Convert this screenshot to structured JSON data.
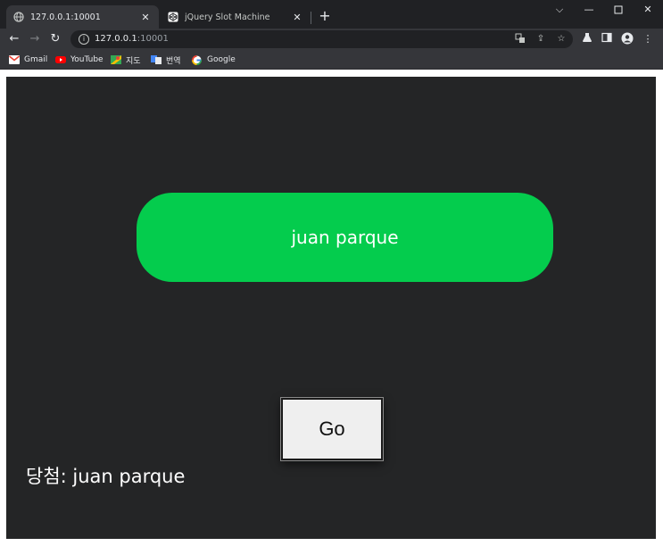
{
  "browser": {
    "tabs": [
      {
        "title": "127.0.0.1:10001",
        "active": true
      },
      {
        "title": "jQuery Slot Machine",
        "active": false
      }
    ],
    "new_tab_glyph": "+",
    "url_host": "127.0.0.1",
    "url_port": ":10001",
    "bookmarks": [
      {
        "label": "Gmail",
        "icon": "gmail-icon",
        "color": "#ea4335"
      },
      {
        "label": "YouTube",
        "icon": "youtube-icon",
        "color": "#ff0000"
      },
      {
        "label": "지도",
        "icon": "maps-icon",
        "color": "#34a853"
      },
      {
        "label": "번역",
        "icon": "translate-icon",
        "color": "#4285f4"
      },
      {
        "label": "Google",
        "icon": "google-icon",
        "color": "#4285f4"
      }
    ]
  },
  "page": {
    "background": "#242526",
    "slot_value": "juan parque",
    "slot_color": "#04cc4d",
    "go_label": "Go",
    "winner_text": "당첨: juan parque"
  }
}
